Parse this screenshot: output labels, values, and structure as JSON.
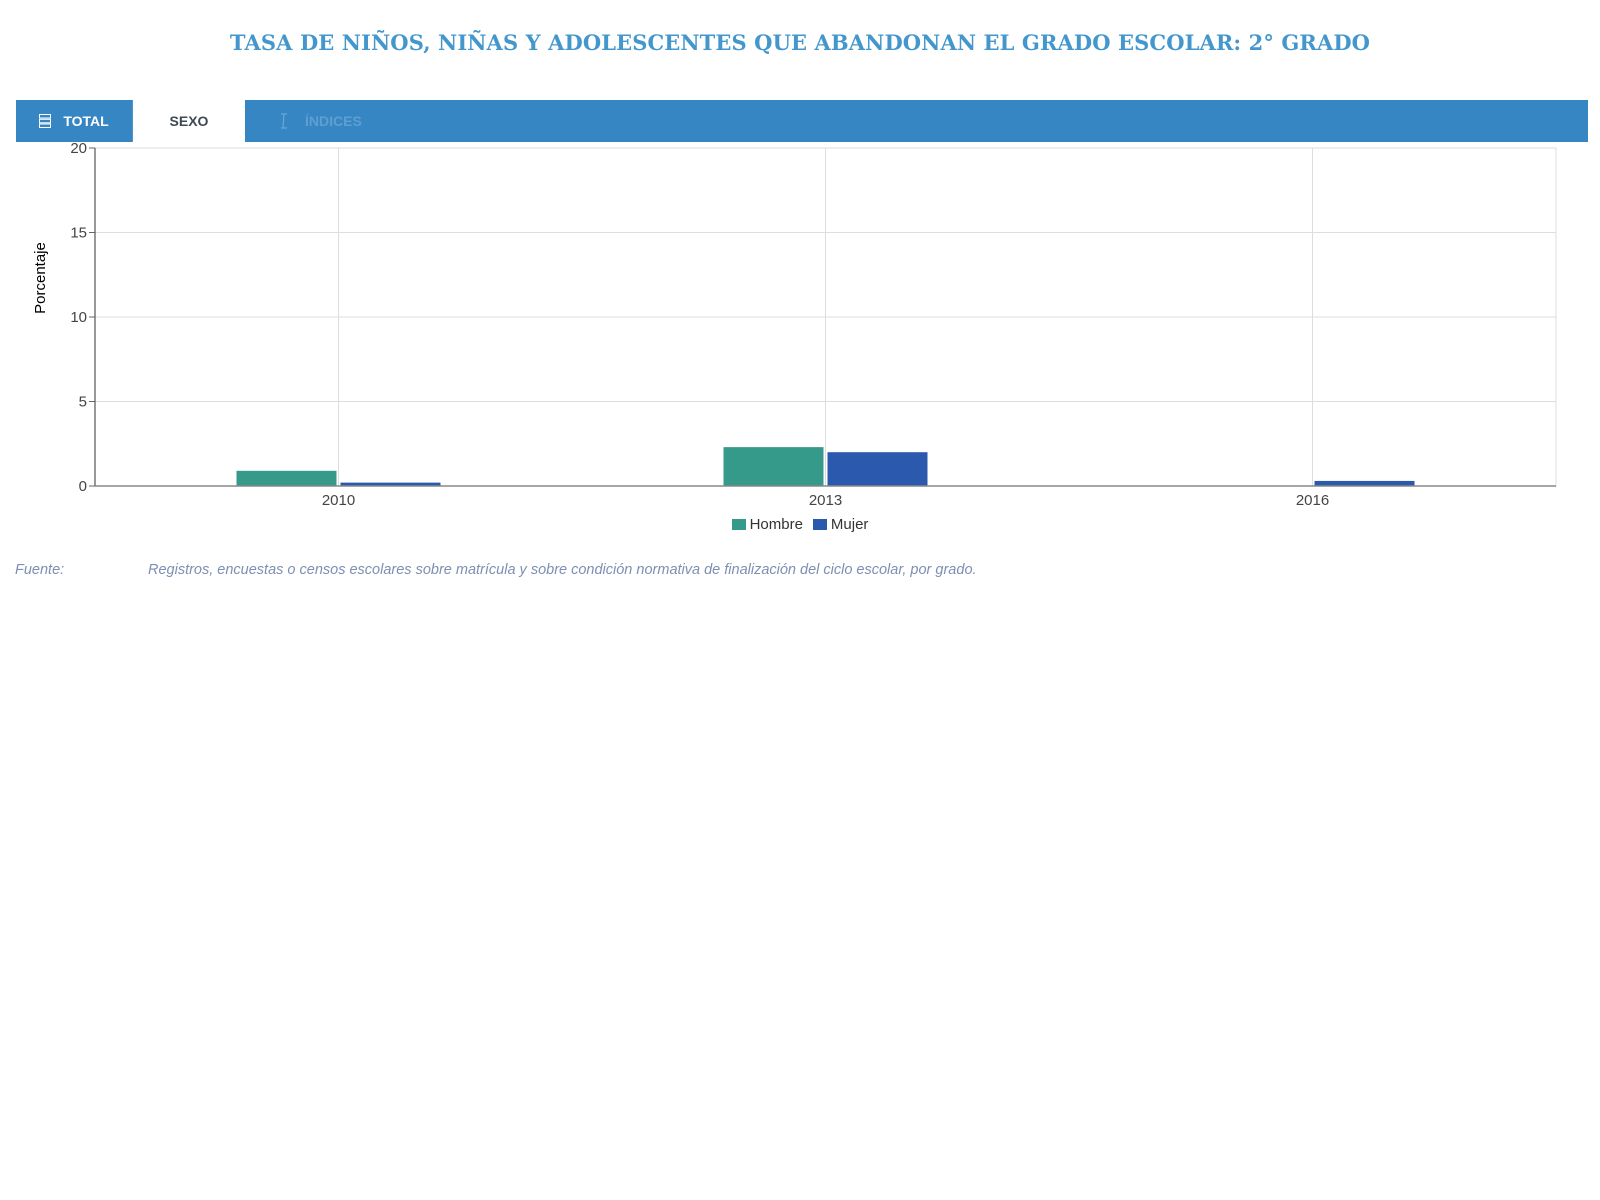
{
  "title": "TASA DE NIÑOS, NIÑAS Y ADOLESCENTES QUE ABANDONAN EL GRADO ESCOLAR: 2° GRADO",
  "tabs": {
    "total": "TOTAL",
    "sexo": "SEXO",
    "indices": "ÍNDICES"
  },
  "icons": {
    "total": "list-icon",
    "indices": "text-cursor-icon"
  },
  "chart_data": {
    "type": "bar",
    "categories": [
      "2010",
      "2013",
      "2016"
    ],
    "series": [
      {
        "name": "Hombre",
        "values": [
          0.9,
          2.3,
          null
        ],
        "color": "#359a89"
      },
      {
        "name": "Mujer",
        "values": [
          0.2,
          2.0,
          0.3
        ],
        "color": "#2a59ad"
      }
    ],
    "ylabel": "Porcentaje",
    "xlabel": "",
    "ylim": [
      0,
      20
    ],
    "yticks": [
      0,
      5,
      10,
      15,
      20
    ],
    "grid": true,
    "legend": "bottom-center"
  },
  "source": {
    "label": "Fuente:",
    "text": "Registros, encuestas o censos escolares sobre matrícula y sobre condición normativa de finalización del ciclo escolar, por grado."
  }
}
